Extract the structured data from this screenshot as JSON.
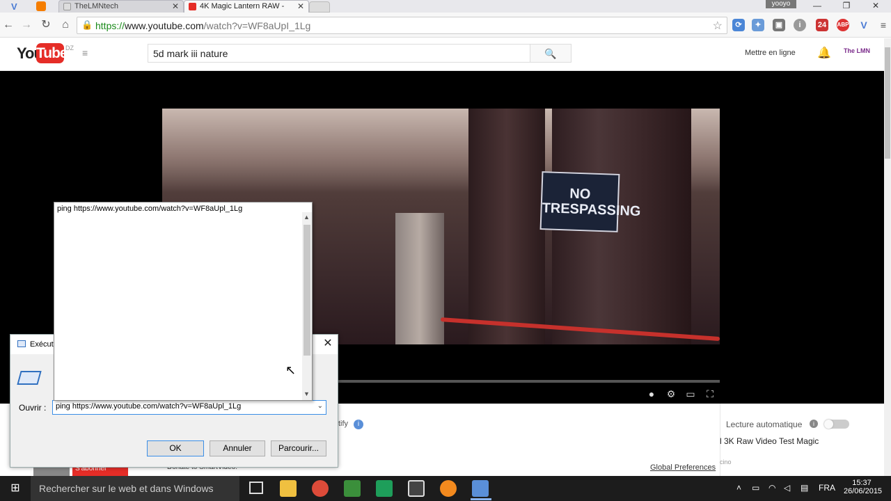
{
  "browser": {
    "tabs": [
      {
        "label": "TheLMNtech",
        "favicon_color": "#e8772e"
      },
      {
        "label": "4K Magic Lantern RAW - ",
        "favicon_color": "#e52d27"
      }
    ],
    "profile": "yooyo",
    "url_scheme": "https://",
    "url_host": "www.youtube.com",
    "url_path": "/watch?v=WF8aUpI_1Lg",
    "extension_badges": [
      "24",
      "ABP"
    ]
  },
  "youtube": {
    "logo_you": "You",
    "logo_tube": "Tube",
    "region": "DZ",
    "search_value": "5d mark iii nature",
    "upload_label": "Mettre en ligne",
    "channel_label": "The LMN",
    "autoplay_label": "Lecture automatique",
    "next_title": "l 3K Raw Video Test Magic",
    "next_meta": "cino",
    "global_prefs": "Global Preferences",
    "notify_text": "tify",
    "subscribe_label": "S'abonner",
    "donate_text": "Donate to SmartVideo!",
    "sign_text": "NO TRESPASSING"
  },
  "run_dialog": {
    "title": "Exécuter",
    "open_label": "Ouvrir :",
    "open_value": "ping https://www.youtube.com/watch?v=WF8aUpl_1Lg",
    "ok_label": "OK",
    "cancel_label": "Annuler",
    "browse_label": "Parcourir...",
    "autocomplete": [
      "ping https://www.youtube.com/watch?v=WF8aUpl_1Lg"
    ]
  },
  "taskbar": {
    "search_placeholder": "Rechercher sur le web et dans Windows",
    "lang": "FRA",
    "time": "15:37",
    "date": "26/06/2015"
  }
}
